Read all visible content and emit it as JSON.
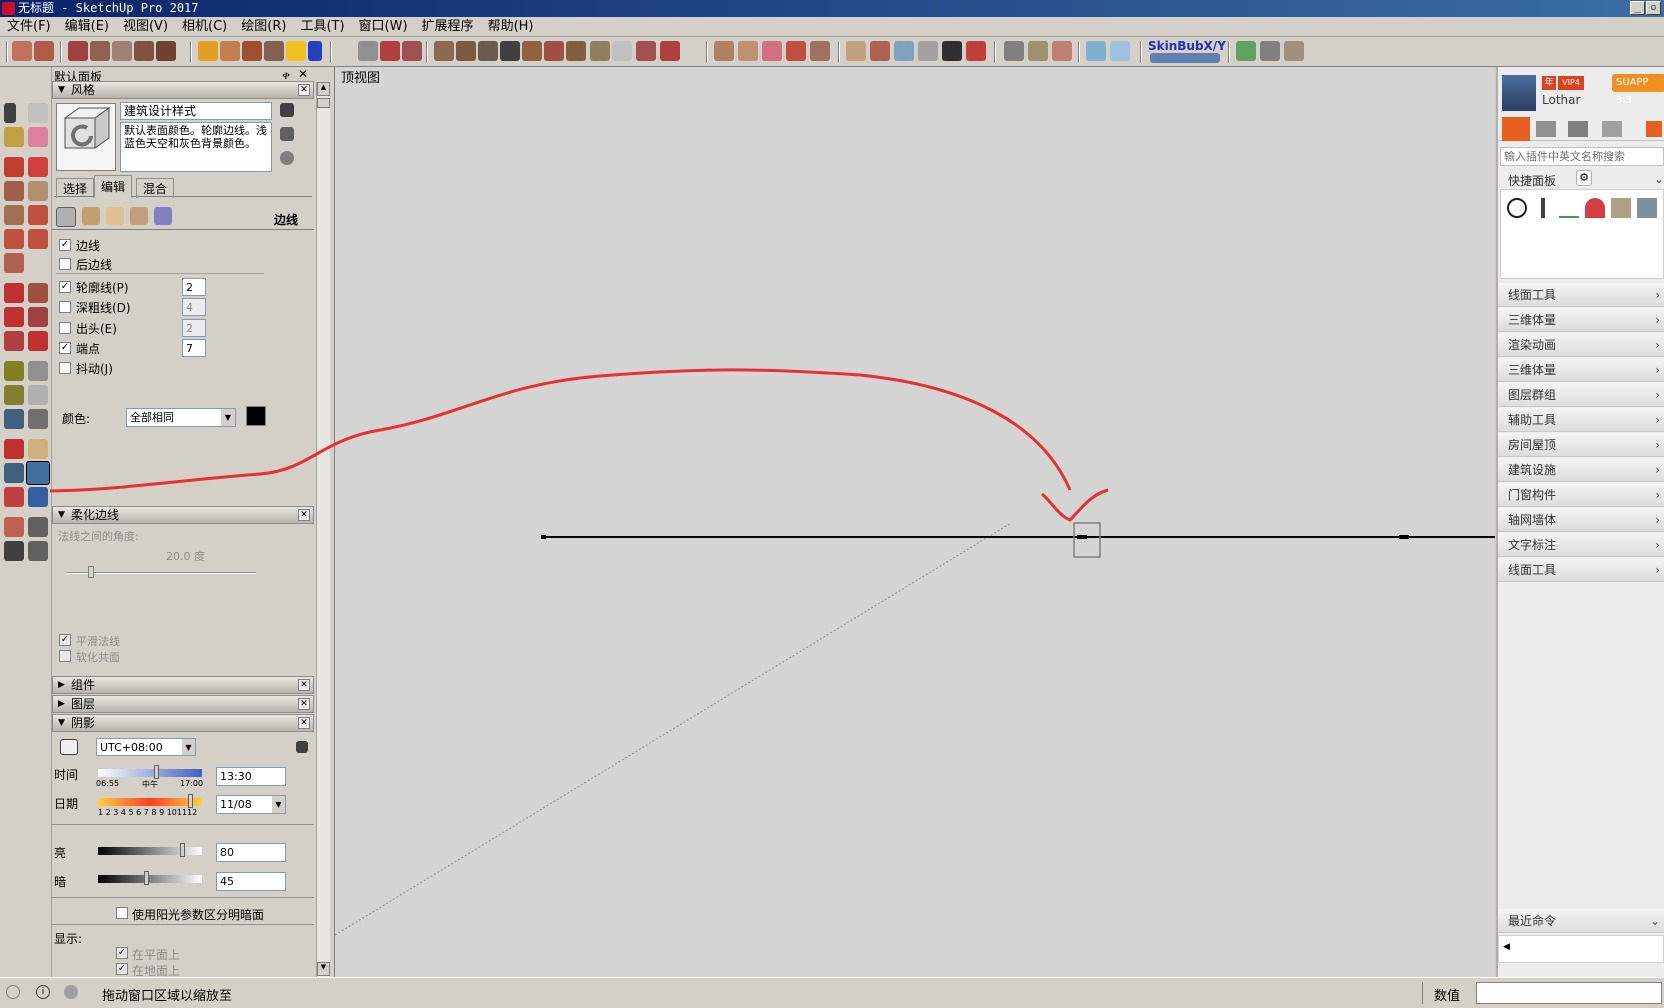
{
  "window": {
    "title": "无标题 - SketchUp Pro 2017",
    "min_btn": "_",
    "max_btn": "▫",
    "close_btn": "✕"
  },
  "menu": [
    "文件(F)",
    "编辑(E)",
    "视图(V)",
    "相机(C)",
    "绘图(R)",
    "工具(T)",
    "窗口(W)",
    "扩展程序",
    "帮助(H)"
  ],
  "toolbar": {
    "skinbub_label": "SkinBubX/Y"
  },
  "tray": {
    "title": "默认面板",
    "pin": "ቀ",
    "close": "✕"
  },
  "styles": {
    "title": "风格",
    "style_name": "建筑设计样式",
    "style_desc": "默认表面颜色。轮廓边线。浅蓝色天空和灰色背景颜色。",
    "tabs": [
      "选择",
      "编辑",
      "混合"
    ],
    "active_tab": "编辑",
    "section_label": "边线",
    "edges": {
      "edges": {
        "label": "边线",
        "checked": true
      },
      "back_edges": {
        "label": "后边线",
        "checked": false
      },
      "profiles": {
        "label": "轮廓线(P)",
        "checked": true,
        "value": "2"
      },
      "depth_cue": {
        "label": "深粗线(D)",
        "checked": false,
        "value": "4"
      },
      "extension": {
        "label": "出头(E)",
        "checked": false,
        "value": "2"
      },
      "endpoints": {
        "label": "端点",
        "checked": true,
        "value": "7"
      },
      "jitter": {
        "label": "抖动(J)",
        "checked": false
      }
    },
    "color_label": "颜色:",
    "color_value": "全部相同",
    "color_swatch": "#000000"
  },
  "soften": {
    "title": "柔化边线",
    "angle_label": "法线之间的角度:",
    "angle_value": "20.0  度",
    "smooth_normals": "平滑法线",
    "soften_coplanar": "软化共面"
  },
  "components": {
    "title": "组件"
  },
  "layers": {
    "title": "图层"
  },
  "shadows": {
    "title": "阴影",
    "timezone": "UTC+08:00",
    "time_label": "时间",
    "time_start": "06:55",
    "time_mid": "中午",
    "time_end": "17:00",
    "time_value": "13:30",
    "date_label": "日期",
    "date_ticks": "1 2 3 4 5 6 7 8 9 101112",
    "date_value": "11/08",
    "light_label": "亮",
    "light_value": "80",
    "dark_label": "暗",
    "dark_value": "45",
    "use_sun_label": "使用阳光参数区分明暗面",
    "display_label": "显示:",
    "on_faces": "在平面上",
    "on_ground": "在地面上"
  },
  "viewport": {
    "title": "顶视图"
  },
  "suapp": {
    "user": "Lothar",
    "badge_year": "年",
    "badge_vip": "VIP4",
    "version_btn": "SUAPP 3.3",
    "search_placeholder": "输入插件中英文名称搜索",
    "quick_panel": "快捷面板",
    "categories": [
      "线面工具",
      "三维体量",
      "渲染动画",
      "三维体量",
      "图层群组",
      "辅助工具",
      "房间屋顶",
      "建筑设施",
      "门窗构件",
      "轴网墙体",
      "文字标注",
      "线面工具"
    ],
    "recent": "最近命令"
  },
  "status": {
    "hint": "拖动窗口区域以缩放至",
    "measurements_label": "数值",
    "measurements_value": ""
  }
}
